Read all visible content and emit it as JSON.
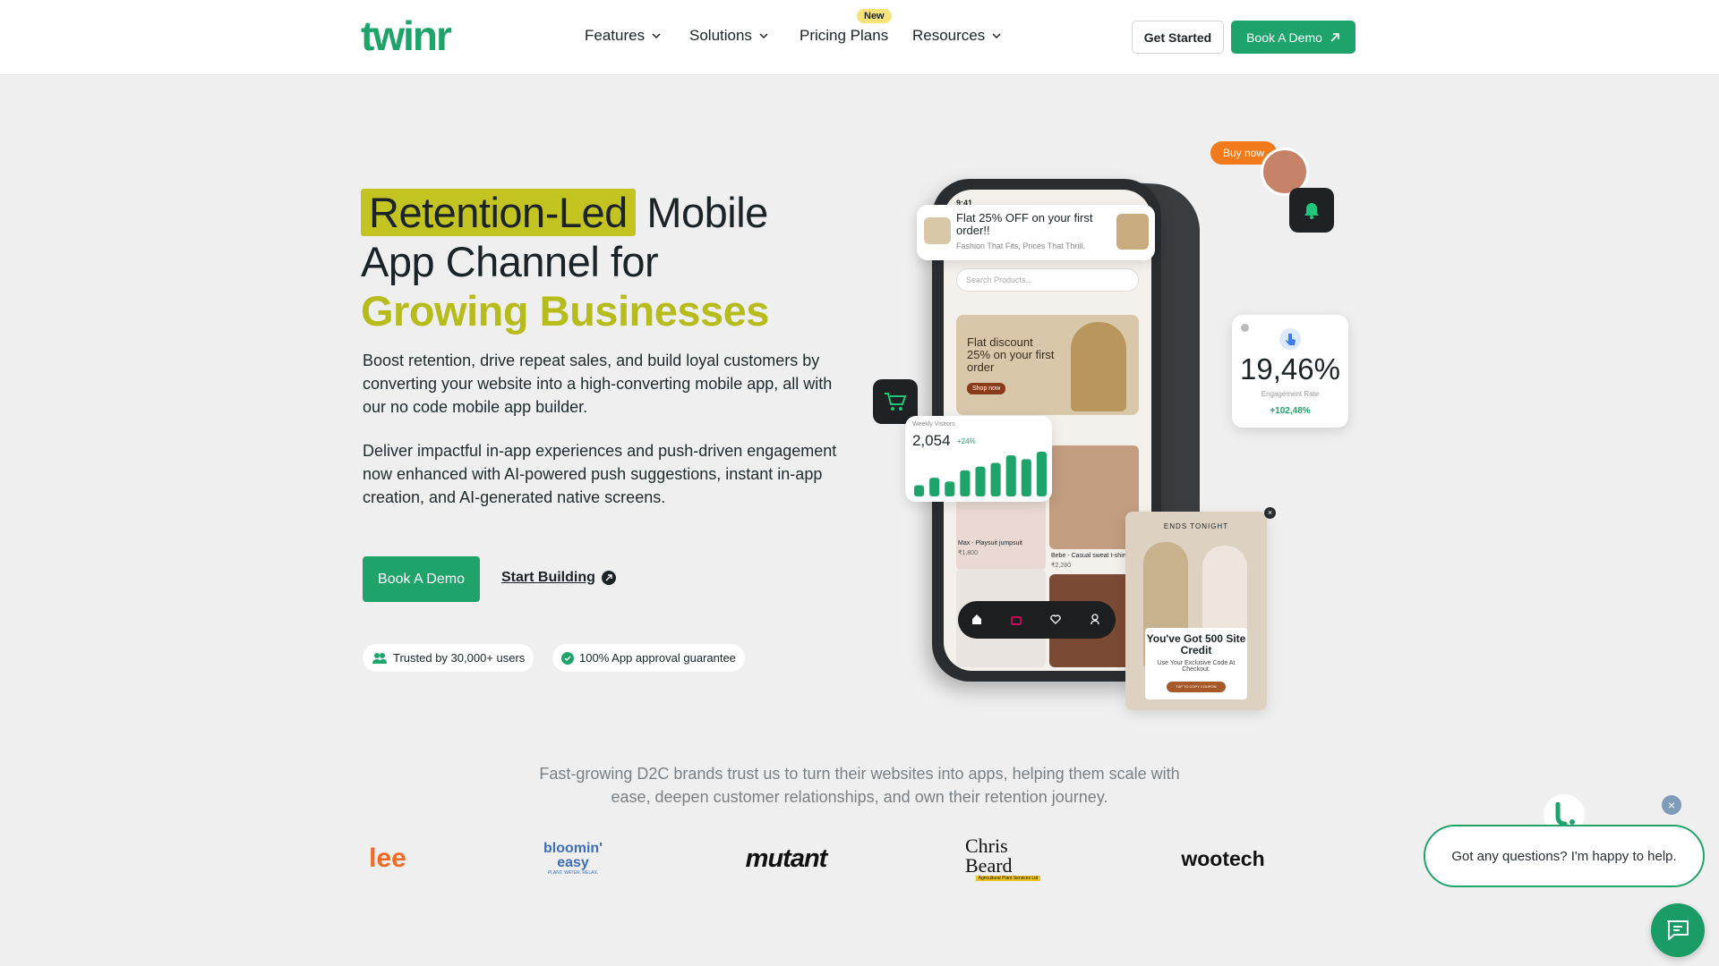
{
  "nav": {
    "logo_text": "twinr",
    "items": [
      {
        "label": "Features"
      },
      {
        "label": "Solutions"
      },
      {
        "label": "Pricing Plans"
      },
      {
        "label": "Resources"
      }
    ],
    "new_badge": "New",
    "get_started": "Get Started",
    "book_demo": "Book A Demo"
  },
  "hero": {
    "title_highlight": "Retention-Led",
    "title_rest_1": " Mobile",
    "title_line2": "App Channel for",
    "title_line3": "Growing Businesses",
    "para1": "Boost retention, drive repeat sales, and build loyal customers by converting your website into a high-converting mobile app, all with our no code mobile app builder.",
    "para2": "Deliver impactful in-app experiences and push-driven engagement now enhanced with AI-powered push suggestions, instant in-app creation, and AI-generated native screens.",
    "cta_primary": "Book A Demo",
    "cta_secondary": "Start Building",
    "pill_users": "Trusted by 30,000+ users",
    "pill_approval": "100% App approval guarantee"
  },
  "mockup": {
    "buy_now": "Buy now",
    "notif_title": "Flat 25% OFF on your first order!!",
    "notif_sub": "Fashion That Fits, Prices That Thrill.",
    "search_placeholder": "Search Products...",
    "banner_text": "Flat discount 25% on your first order",
    "banner_btn": "Shop now",
    "visitors_label": "Weekly Visitors",
    "visitors_value": "2,054",
    "visitors_delta": "+24%",
    "visitors_bars": [
      3,
      5,
      4,
      7,
      8,
      9,
      11,
      10,
      12
    ],
    "engagement_value": "19,46%",
    "engagement_label": "Engagement Rate",
    "engagement_delta": "+102,48%",
    "product1_name": "Max - Playsuit jumpsuit",
    "product1_price": "₹1,800",
    "product2_name": "Bebe - Casual sweat t-shirt",
    "product2_price": "₹2,280",
    "popup_ends": "ENDS TONIGHT",
    "popup_title": "You've Got 500 Site Credit",
    "popup_sub": "Use Your Exclusive Code At Checkout.",
    "popup_btn": "TAP TO COPY COUPON"
  },
  "trust_text": "Fast-growing D2C brands trust us to turn their websites into apps, helping them scale with ease, deepen customer relationships, and own their retention journey.",
  "brands": [
    "lee",
    "bloomin' easy",
    "mutant",
    "Chris Beard",
    "wootech"
  ],
  "brand_sub": {
    "bloomin": "PLANT. WATER. RELAX.",
    "chrisbeard": "Agricultural Plant Services Ltd"
  },
  "chat": {
    "message": "Got any questions? I'm happy to help."
  },
  "colors": {
    "brand_green": "#1ea46b",
    "highlight": "#c3c321",
    "headline_green": "#b6bc1c",
    "badge": "#f8e27a"
  }
}
